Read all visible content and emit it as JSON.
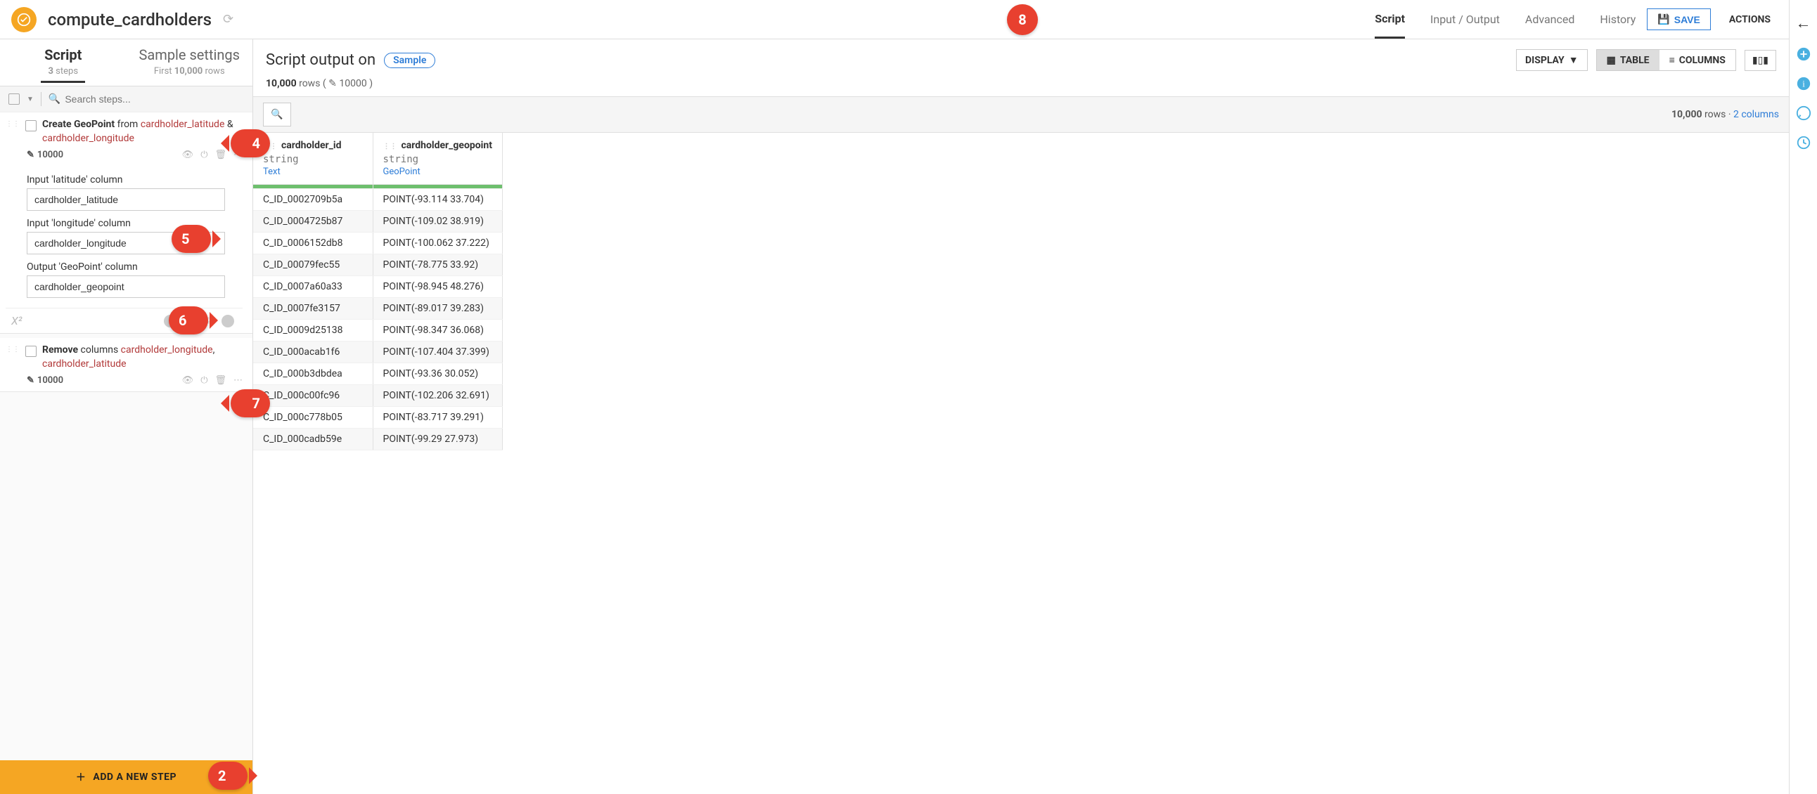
{
  "topbar": {
    "title": "compute_cardholders",
    "tabs": {
      "script": "Script",
      "io": "Input / Output",
      "advanced": "Advanced",
      "history": "History"
    },
    "save_label": "SAVE",
    "actions_label": "ACTIONS"
  },
  "sidebar": {
    "tab_script": "Script",
    "tab_sample": "Sample settings",
    "sub_script_prefix": "3",
    "sub_script_suffix": " steps",
    "sub_sample_prefix": "First ",
    "sub_sample_mid": "10,000",
    "sub_sample_suffix": " rows",
    "search_placeholder": "Search steps...",
    "step1": {
      "verb": "Create GeoPoint",
      "mid": " from ",
      "tok1": "cardholder_latitude",
      "amp": " & ",
      "tok2": "cardholder_longitude",
      "count": "10000",
      "lat_label": "Input 'latitude' column",
      "lat_value": "cardholder_latitude",
      "lng_label": "Input 'longitude' column",
      "lng_value": "cardholder_longitude",
      "out_label": "Output 'GeoPoint' column",
      "out_value": "cardholder_geopoint"
    },
    "step2": {
      "verb": "Remove",
      "mid": " columns ",
      "tok1": "cardholder_longitude",
      "sep": ", ",
      "tok2": "cardholder_latitude",
      "count": "10000"
    },
    "add_step": "ADD A NEW STEP"
  },
  "content": {
    "title": "Script output on",
    "sample_pill": "Sample",
    "display": "DISPLAY",
    "table": "TABLE",
    "columns": "COLUMNS",
    "rows_strong": "10,000",
    "rows_suffix": " rows  ( ",
    "edit_count": " 10000",
    "rows_close": " )",
    "tb_rows_strong": "10,000",
    "tb_rows_suffix": " rows",
    "tb_sep": "  ·  ",
    "tb_cols": "2 columns"
  },
  "table": {
    "col1": {
      "name": "cardholder_id",
      "type": "string",
      "kind": "Text"
    },
    "col2": {
      "name": "cardholder_geopoint",
      "type": "string",
      "kind": "GeoPoint"
    },
    "rows": [
      {
        "c1": "C_ID_0002709b5a",
        "c2": "POINT(-93.114 33.704)"
      },
      {
        "c1": "C_ID_0004725b87",
        "c2": "POINT(-109.02 38.919)"
      },
      {
        "c1": "C_ID_0006152db8",
        "c2": "POINT(-100.062 37.222)"
      },
      {
        "c1": "C_ID_00079fec55",
        "c2": "POINT(-78.775 33.92)"
      },
      {
        "c1": "C_ID_0007a60a33",
        "c2": "POINT(-98.945 48.276)"
      },
      {
        "c1": "C_ID_0007fe3157",
        "c2": "POINT(-89.017 39.283)"
      },
      {
        "c1": "C_ID_0009d25138",
        "c2": "POINT(-98.347 36.068)"
      },
      {
        "c1": "C_ID_000acab1f6",
        "c2": "POINT(-107.404 37.399)"
      },
      {
        "c1": "C_ID_000b3dbdea",
        "c2": "POINT(-93.36 30.052)"
      },
      {
        "c1": "C_ID_000c00fc96",
        "c2": "POINT(-102.206 32.691)"
      },
      {
        "c1": "C_ID_000c778b05",
        "c2": "POINT(-83.717 39.291)"
      },
      {
        "c1": "C_ID_000cadb59e",
        "c2": "POINT(-99.29 27.973)"
      }
    ]
  },
  "callouts": {
    "c2": "2",
    "c4": "4",
    "c5": "5",
    "c6": "6",
    "c7": "7",
    "c8": "8"
  }
}
